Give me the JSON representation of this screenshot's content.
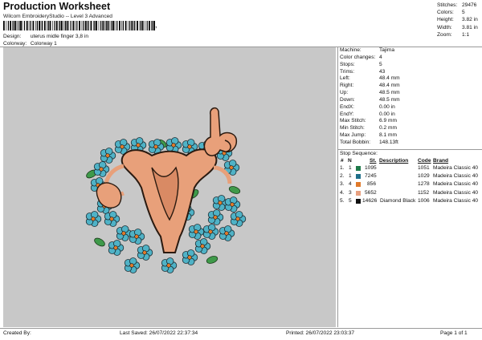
{
  "header": {
    "title": "Production Worksheet",
    "subtitle": "Wilcom EmbroideryStudio -- Level 3 Advanced",
    "barcode_suffix": ","
  },
  "design_info": [
    {
      "label": "Design:",
      "value": "uterus midle finger 3,8 in"
    },
    {
      "label": "Colorway:",
      "value": "Colorway 1"
    }
  ],
  "stats": [
    {
      "label": "Stitches:",
      "value": "29476"
    },
    {
      "label": "Colors:",
      "value": "5"
    },
    {
      "label": "Height:",
      "value": "3.82 in"
    },
    {
      "label": "Width:",
      "value": "3.81 in"
    },
    {
      "label": "Zoom:",
      "value": "1:1"
    }
  ],
  "machine_info": [
    {
      "label": "Machine:",
      "value": "Tajima"
    },
    {
      "label": "Color changes:",
      "value": "4"
    },
    {
      "label": "Stops:",
      "value": "5"
    },
    {
      "label": "Trims:",
      "value": "43"
    },
    {
      "label": "Left:",
      "value": "48.4 mm"
    },
    {
      "label": "Right:",
      "value": "48.4 mm"
    },
    {
      "label": "Up:",
      "value": "48.5 mm"
    },
    {
      "label": "Down:",
      "value": "48.5 mm"
    },
    {
      "label": "EndX:",
      "value": "0.00 in"
    },
    {
      "label": "EndY:",
      "value": "0.00 in"
    },
    {
      "label": "Max Stitch:",
      "value": "6.9 mm"
    },
    {
      "label": "Min Stitch:",
      "value": "0.2 mm"
    },
    {
      "label": "Max Jump:",
      "value": "8.1 mm"
    },
    {
      "label": "Total Bobbin:",
      "value": "148.13ft"
    }
  ],
  "stop_sequence": {
    "title": "Stop Sequence:",
    "headers": {
      "num": "#",
      "n": "N",
      "st": "St.",
      "description": "Description",
      "code": "Code",
      "brand": "Brand"
    },
    "rows": [
      {
        "num": "1.",
        "n": "1",
        "color": "#1f7a4a",
        "st": "1095",
        "description": "",
        "code": "1051",
        "brand": "Madeira Classic 40"
      },
      {
        "num": "2.",
        "n": "1",
        "color": "#1f6f8a",
        "st": "7245",
        "description": "",
        "code": "1029",
        "brand": "Madeira Classic 40"
      },
      {
        "num": "3.",
        "n": "4",
        "color": "#e07a2a",
        "st": "856",
        "description": "",
        "code": "1278",
        "brand": "Madeira Classic 40"
      },
      {
        "num": "4.",
        "n": "3",
        "color": "#e8a080",
        "st": "5652",
        "description": "",
        "code": "1152",
        "brand": "Madeira Classic 40"
      },
      {
        "num": "5.",
        "n": "5",
        "color": "#111111",
        "st": "14626",
        "description": "Diamond Black",
        "code": "1006",
        "brand": "Madeira Classic 40"
      }
    ]
  },
  "footer": {
    "created_by": "Created By:",
    "last_saved": "Last Saved: 26/07/2022 22:37:34",
    "printed": "Printed: 26/07/2022 23:03:37",
    "page": "Page 1 of 1"
  }
}
